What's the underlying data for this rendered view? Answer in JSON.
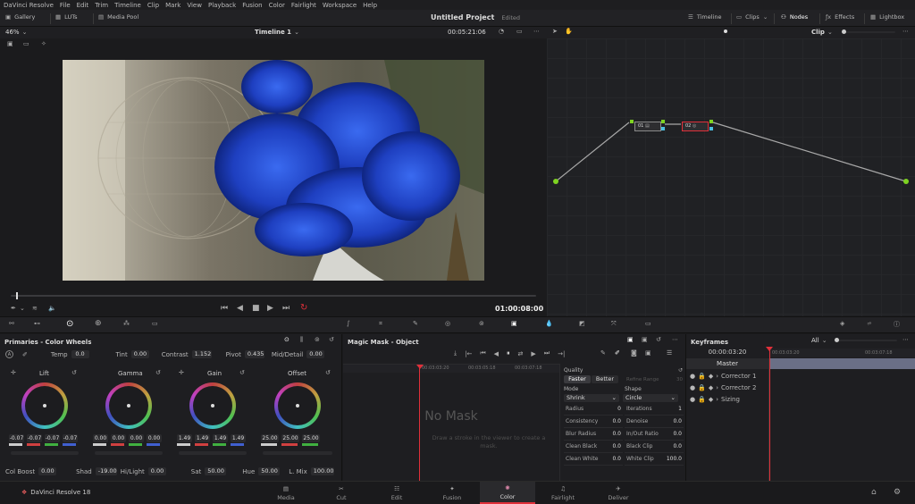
{
  "menu": {
    "items": [
      "DaVinci Resolve",
      "File",
      "Edit",
      "Trim",
      "Timeline",
      "Clip",
      "Mark",
      "View",
      "Playback",
      "Fusion",
      "Color",
      "Fairlight",
      "Workspace",
      "Help"
    ]
  },
  "toolbar": {
    "gallery": "Gallery",
    "luts": "LUTs",
    "media_pool": "Media Pool",
    "project_title": "Untitled Project",
    "project_status": "Edited",
    "timeline": "Timeline",
    "clips": "Clips",
    "nodes": "Nodes",
    "effects": "Effects",
    "lightbox": "Lightbox"
  },
  "viewer": {
    "zoom": "46%",
    "timeline_name": "Timeline 1",
    "timecode": "00:05:21:06",
    "playhead": 0.01,
    "current_timecode": "01:00:08:00"
  },
  "nodes": {
    "mode": "Clip",
    "node1": "01",
    "node2": "02"
  },
  "wheels": {
    "title": "Primaries - Color Wheels",
    "temp_label": "Temp",
    "temp": "0.0",
    "tint_label": "Tint",
    "tint": "0.00",
    "contrast_label": "Contrast",
    "contrast": "1.152",
    "pivot_label": "Pivot",
    "pivot": "0.435",
    "middetail_label": "Mid/Detail",
    "middetail": "0.00",
    "lift": {
      "label": "Lift",
      "values": [
        "-0.07",
        "-0.07",
        "-0.07",
        "-0.07"
      ]
    },
    "gamma": {
      "label": "Gamma",
      "values": [
        "0.00",
        "0.00",
        "0.00",
        "0.00"
      ]
    },
    "gain": {
      "label": "Gain",
      "values": [
        "1.49",
        "1.49",
        "1.49",
        "1.49"
      ]
    },
    "offset": {
      "label": "Offset",
      "values": [
        "25.00",
        "25.00",
        "25.00",
        "25.00"
      ]
    },
    "colboost_label": "Col Boost",
    "colboost": "0.00",
    "shad_label": "Shad",
    "shad": "-19.00",
    "hilight_label": "Hi/Light",
    "hilight": "0.00",
    "sat_label": "Sat",
    "sat": "50.00",
    "hue_label": "Hue",
    "hue": "50.00",
    "lmix_label": "L. Mix",
    "lmix": "100.00"
  },
  "mask": {
    "title": "Magic Mask - Object",
    "tc1": "00:03:03:20",
    "tc2": "00:03:05:18",
    "tc3": "00:03:07:18",
    "empty_title": "No Mask",
    "empty_hint": "Draw a stroke in the viewer to create a mask.",
    "quality_label": "Quality",
    "faster": "Faster",
    "better": "Better",
    "refine_label": "Refine Range",
    "refine_val": "30",
    "mode_label": "Mode",
    "mode_val": "Shrink",
    "shape_label": "Shape",
    "shape_val": "Circle",
    "radius_label": "Radius",
    "radius": "0",
    "iterations_label": "Iterations",
    "iterations": "1",
    "consistency_label": "Consistency",
    "consistency": "0.0",
    "denoise_label": "Denoise",
    "denoise": "0.0",
    "blur_label": "Blur Radius",
    "blur": "0.0",
    "inout_label": "In/Out Ratio",
    "inout": "0.0",
    "cleanblack_label": "Clean Black",
    "cleanblack": "0.0",
    "blackclip_label": "Black Clip",
    "blackclip": "0.0",
    "cleanwhite_label": "Clean White",
    "cleanwhite": "0.0",
    "whiteclip_label": "White Clip",
    "whiteclip": "100.0"
  },
  "keyframes": {
    "title": "Keyframes",
    "filter": "All",
    "tc": "00:00:03:20",
    "tc_a": "00:03:03:20",
    "tc_b": "00:03:07:18",
    "master": "Master",
    "rows": [
      "Corrector 1",
      "Corrector 2",
      "Sizing"
    ]
  },
  "pages": {
    "app": "DaVinci Resolve 18",
    "items": [
      "Media",
      "Cut",
      "Edit",
      "Fusion",
      "Color",
      "Fairlight",
      "Deliver"
    ],
    "active": "Color"
  },
  "colors": {
    "accent": "#e0303a",
    "node_green": "#7ed321"
  }
}
